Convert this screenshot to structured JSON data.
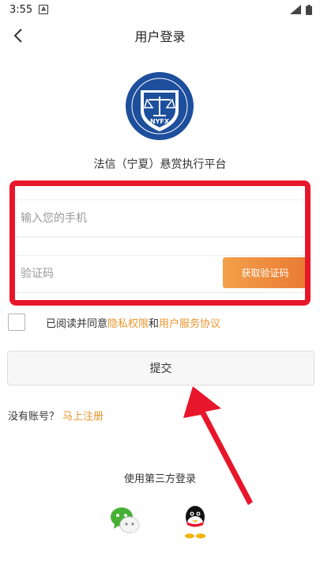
{
  "status_bar": {
    "time": "3:55",
    "notification_icon": "a-square-icon",
    "signal_icon": "signal-icon",
    "battery_icon": "battery-icon"
  },
  "header": {
    "title": "用户登录",
    "back_icon": "chevron-left-icon"
  },
  "logo": {
    "text": "NYFX",
    "color": "#1d4f9c"
  },
  "platform_name": "法信（宁夏）悬赏执行平台",
  "form": {
    "phone_placeholder": "输入您的手机",
    "code_placeholder": "验证码",
    "get_code_label": "获取验证码"
  },
  "agreement": {
    "prefix": "已阅读并同意",
    "privacy_link": "隐私权限",
    "and": "和",
    "service_link": "用户服务协议"
  },
  "submit_label": "提交",
  "register": {
    "prompt": "没有账号？",
    "link": "马上注册"
  },
  "third_party": {
    "title": "使用第三方登录",
    "providers": [
      "wechat-icon",
      "qq-icon"
    ]
  },
  "colors": {
    "accent": "#e8952c",
    "highlight_red": "#e8162a",
    "logo_blue": "#1d4f9c"
  }
}
